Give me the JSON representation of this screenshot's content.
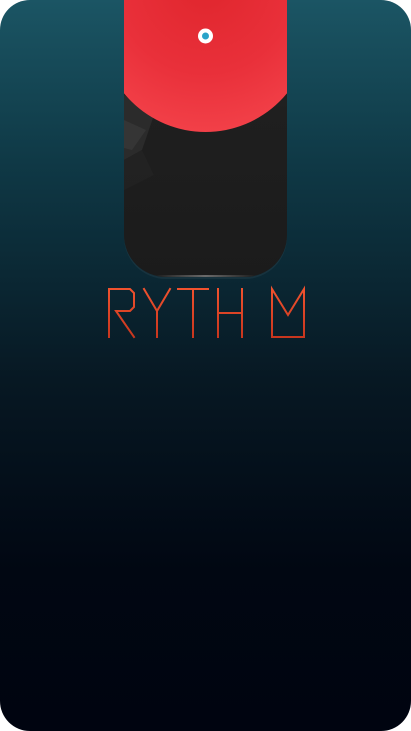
{
  "app": {
    "logo_text": "RYTHM",
    "brand_color": "#e8432e",
    "record_color": "#e92a33",
    "card_color": "#1e1e1e",
    "background_top": "#1b5564",
    "background_bottom": "#000410"
  },
  "artwork": {
    "icon": "vinyl-record-icon"
  }
}
